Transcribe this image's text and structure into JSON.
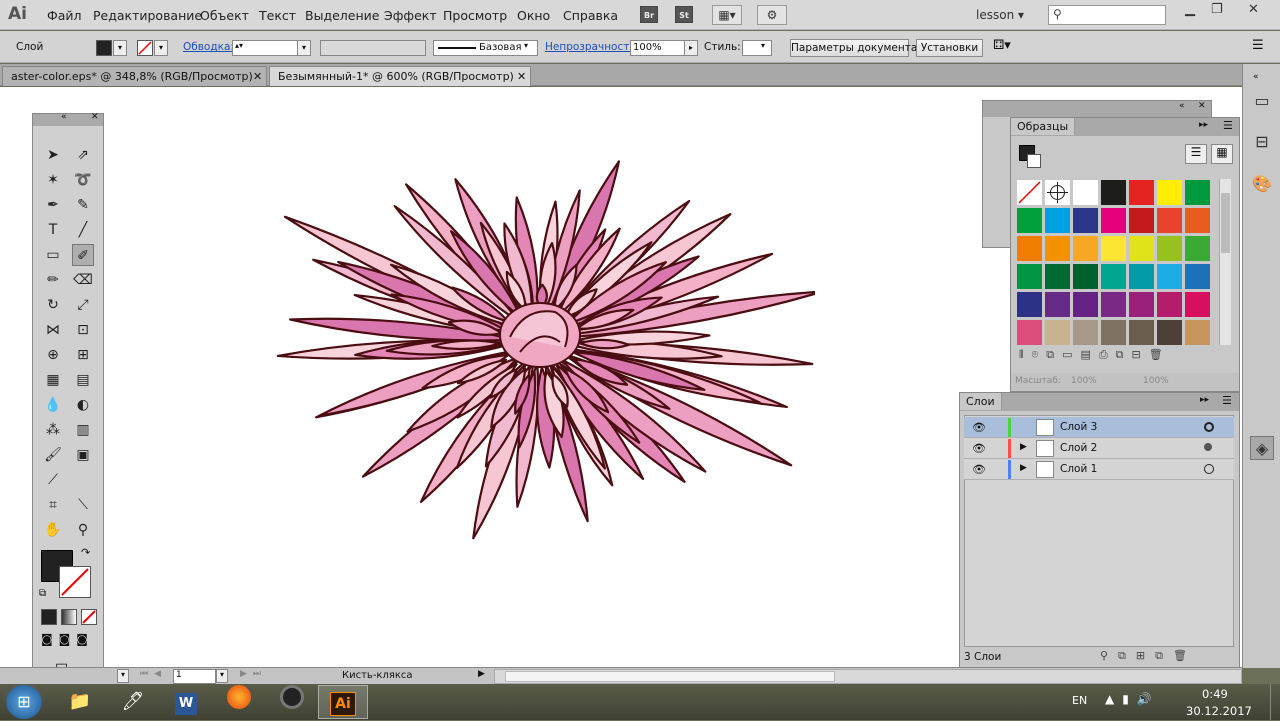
{
  "app": {
    "logo": "Ai"
  },
  "menu": {
    "items": [
      "Файл",
      "Редактирование",
      "Объект",
      "Текст",
      "Выделение",
      "Эффект",
      "Просмотр",
      "Окно",
      "Справка"
    ],
    "bridge": "Br",
    "stock": "St",
    "workspace": "lesson",
    "search_placeholder": ""
  },
  "control": {
    "object_label": "Слой",
    "stroke_link": "Обводка:",
    "stroke_style": "Базовая",
    "opacity_link": "Непрозрачность:",
    "opacity_value": "100%",
    "style_label": "Стиль:",
    "doc_settings_button": "Параметры документа",
    "prefs_button": "Установки"
  },
  "tabs": [
    {
      "label": "aster-color.eps* @ 348,8% (RGB/Просмотр)",
      "active": false
    },
    {
      "label": "Безымянный-1* @ 600% (RGB/Просмотр)",
      "active": true
    }
  ],
  "swatches": {
    "title": "Образцы",
    "colors": [
      "none",
      "register",
      "#ffffff",
      "#1d1d1b",
      "#e52320",
      "#ffed00",
      "#009a3e",
      "#00a13a",
      "#00a0e3",
      "#2c3689",
      "#e5007e",
      "#c51a1b",
      "#e7432d",
      "#e95c1f",
      "#ef7d00",
      "#f39200",
      "#f7a823",
      "#fce533",
      "#e0e21a",
      "#96c11f",
      "#3aaa35",
      "#009540",
      "#006a33",
      "#00612c",
      "#00a68d",
      "#009ca6",
      "#1eaae2",
      "#1d71b8",
      "#2e3287",
      "#652b87",
      "#662283",
      "#7a2a85",
      "#9a217b",
      "#b41d6c",
      "#d80f5e",
      "#dd4d79",
      "#c9b28f",
      "#a89887",
      "#7f7263",
      "#6a5d4d",
      "#4c4039",
      "#c8965c",
      "#a4784f",
      "#8d6443",
      "#6b4a2b",
      "#5a3a1f",
      "#4a2e19",
      "#3a2212"
    ],
    "zoom_left": "100%",
    "zoom_right": "100%",
    "scale_label": "Масштаб:"
  },
  "layers": {
    "title": "Слои",
    "items": [
      {
        "name": "Слой 3",
        "color": "#4cd43c",
        "selected": true
      },
      {
        "name": "Слой 2",
        "color": "#ff4b4b",
        "selected": false
      },
      {
        "name": "Слой 1",
        "color": "#4f7fff",
        "selected": false
      }
    ],
    "count": "3 Слои"
  },
  "status": {
    "page_value": "1",
    "tool_name": "Кисть-клякса"
  },
  "taskbar": {
    "lang": "EN",
    "time": "0:49",
    "date": "30.12.2017",
    "ai_label": "Ai"
  }
}
